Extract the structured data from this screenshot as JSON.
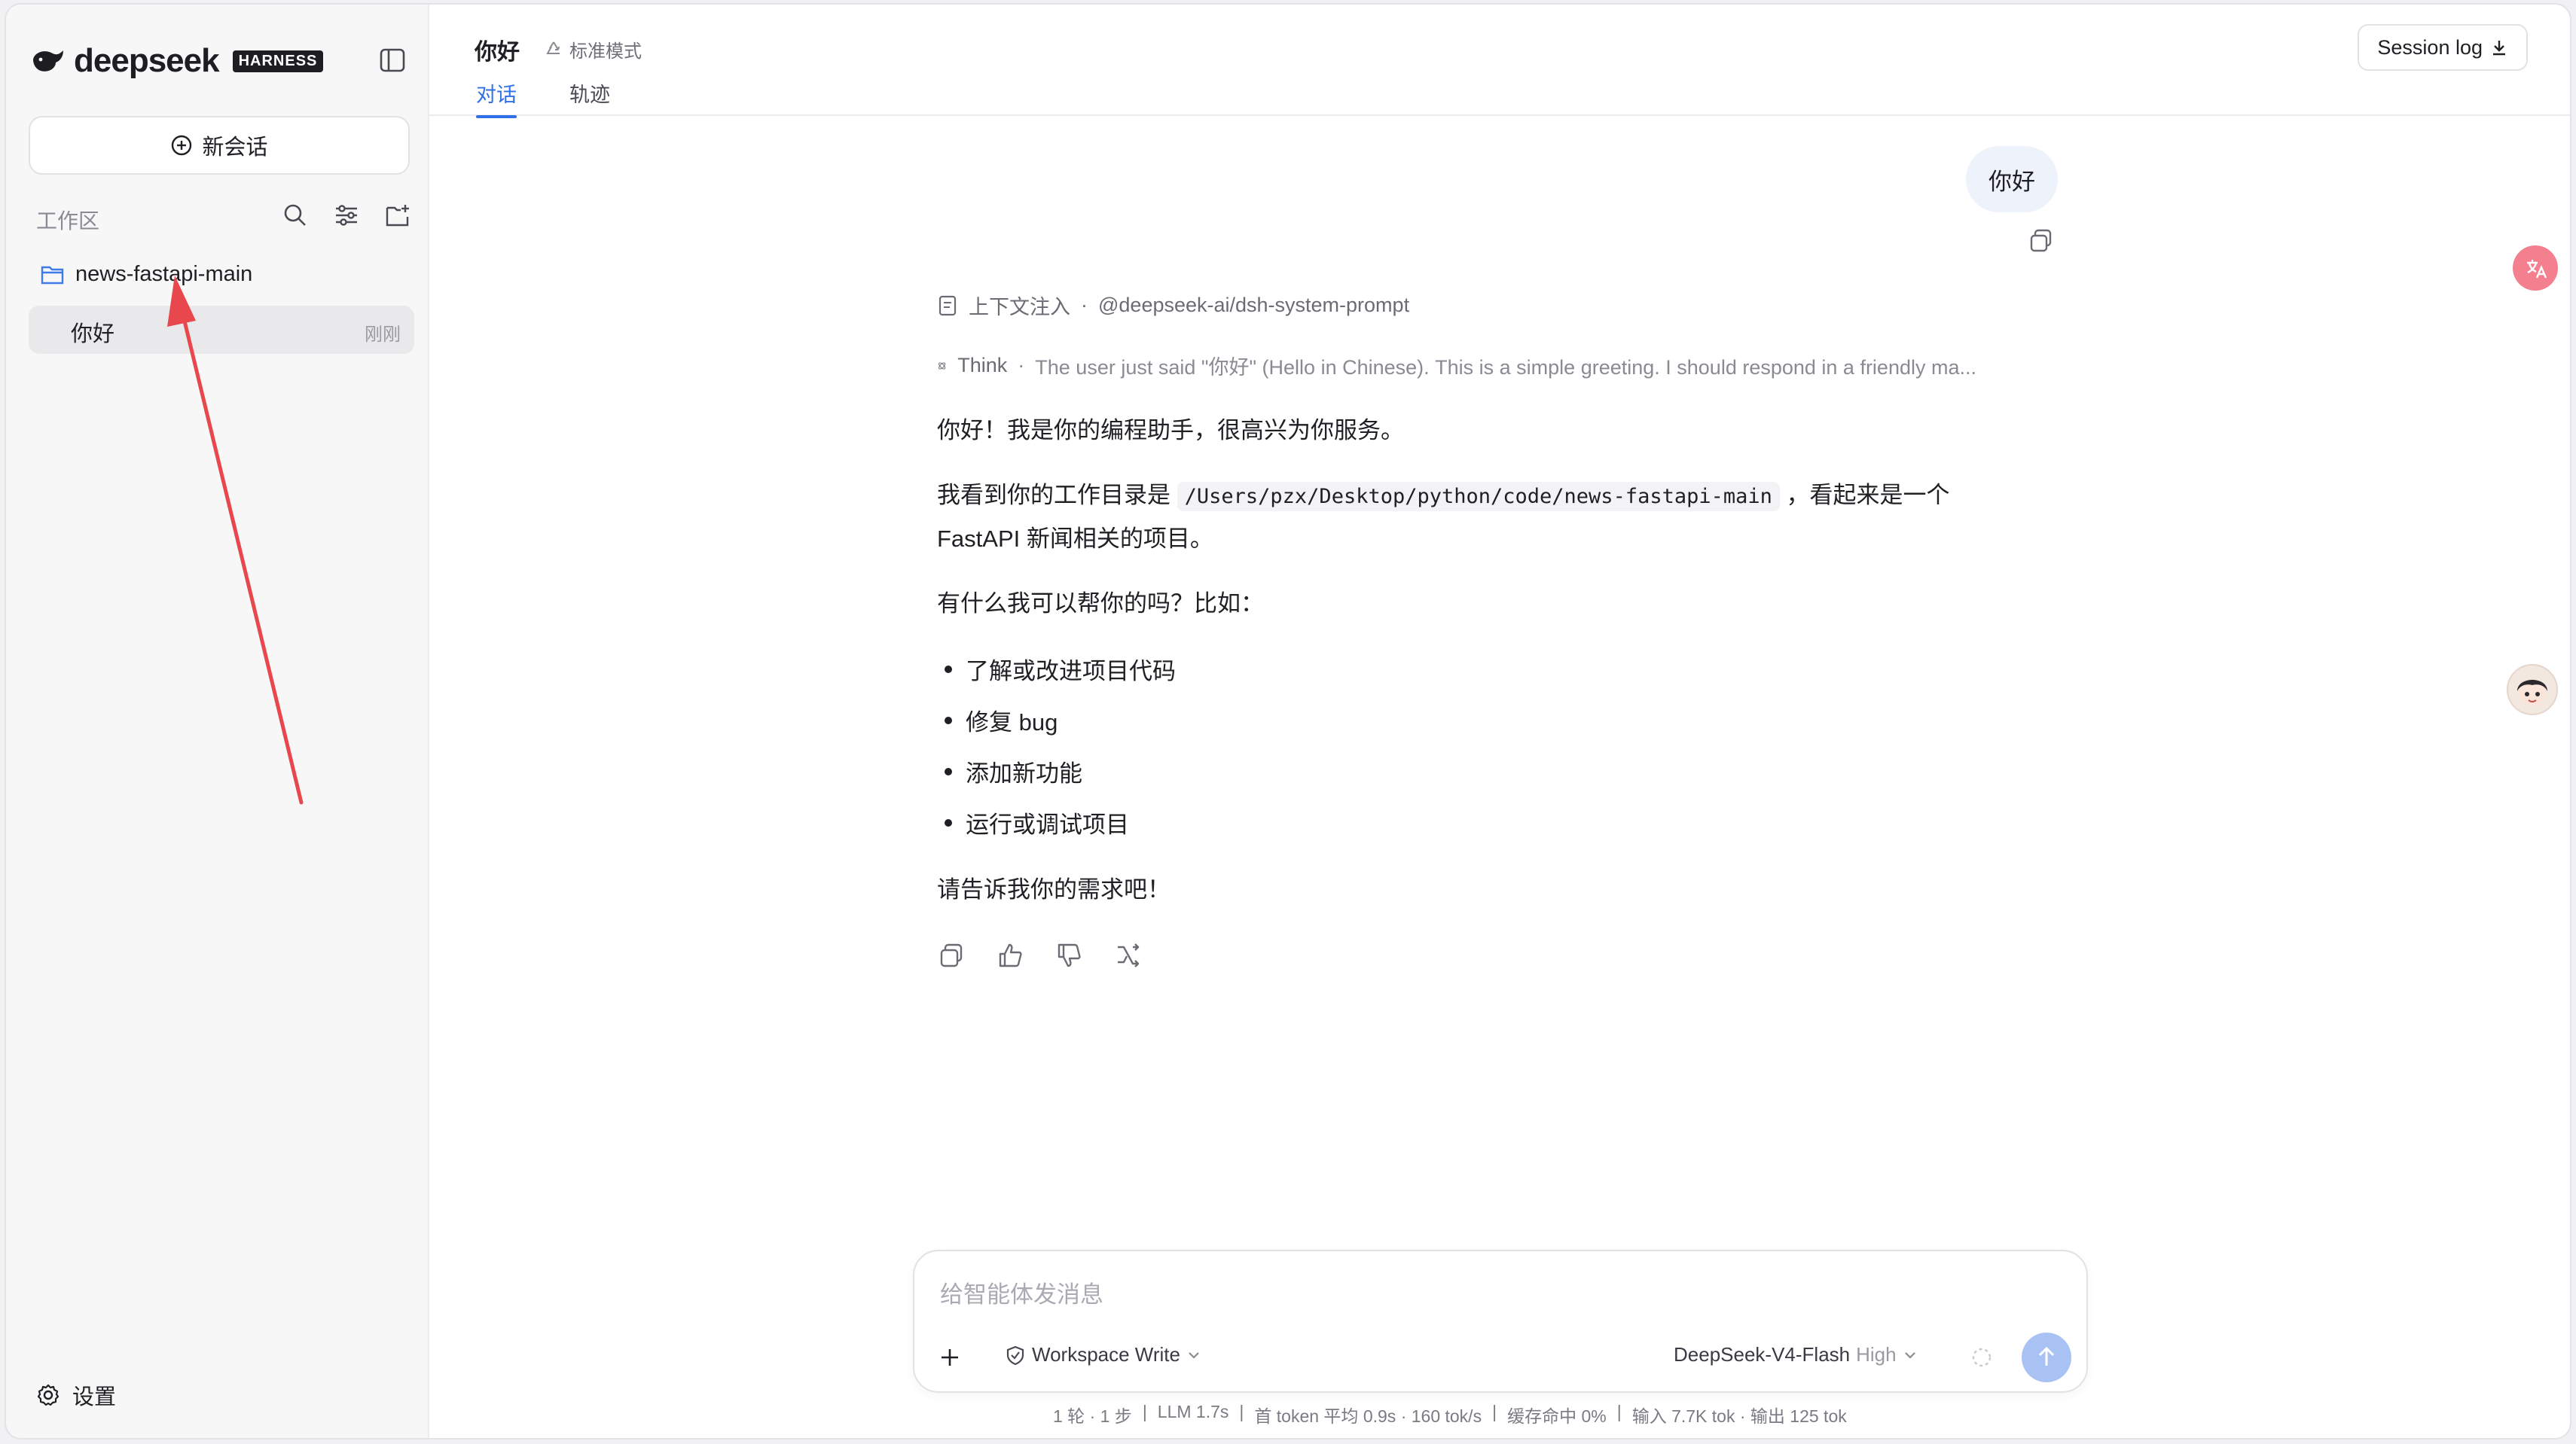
{
  "sidebar": {
    "brand": "deepseek",
    "badge": "HARNESS",
    "new_chat_label": "新会话",
    "workspace_label": "工作区",
    "folder": "news-fastapi-main",
    "sessions": [
      {
        "title": "你好",
        "time": "刚刚"
      }
    ],
    "settings_label": "设置"
  },
  "header": {
    "title": "你好",
    "mode": "标准模式",
    "tabs": [
      {
        "label": "对话",
        "active": true
      },
      {
        "label": "轨迹",
        "active": false
      }
    ],
    "session_log_label": "Session log"
  },
  "conversation": {
    "user_message": "你好",
    "context_label": "上下文注入",
    "context_source": "@deepseek-ai/dsh-system-prompt",
    "think_label": "Think",
    "think_text": "The user just said \"你好\" (Hello in Chinese). This is a simple greeting. I should respond in a friendly ma...",
    "reply": {
      "p1": "你好！我是你的编程助手，很高兴为你服务。",
      "p2_before": "我看到你的工作目录是",
      "p2_code": "/Users/pzx/Desktop/python/code/news-fastapi-main",
      "p2_after": "，看起来是一个",
      "p2_line2": "FastAPI 新闻相关的项目。",
      "p3": "有什么我可以帮你的吗？比如：",
      "bullets": [
        "了解或改进项目代码",
        "修复 bug",
        "添加新功能",
        "运行或调试项目"
      ],
      "p4": "请告诉我你的需求吧！"
    }
  },
  "composer": {
    "placeholder": "给智能体发消息",
    "permission": "Workspace Write",
    "model": "DeepSeek-V4-Flash",
    "level": "High"
  },
  "stats": {
    "turns": "1 轮 · 1 步",
    "llm": "LLM 1.7s",
    "token": "首 token 平均 0.9s · 160 tok/s",
    "cache": "缓存命中 0%",
    "io": "输入 7.7K tok · 输出 125 tok"
  },
  "colors": {
    "accent": "#2f6fe8",
    "send": "#a9c2f4",
    "annotation": "#e8474d"
  }
}
